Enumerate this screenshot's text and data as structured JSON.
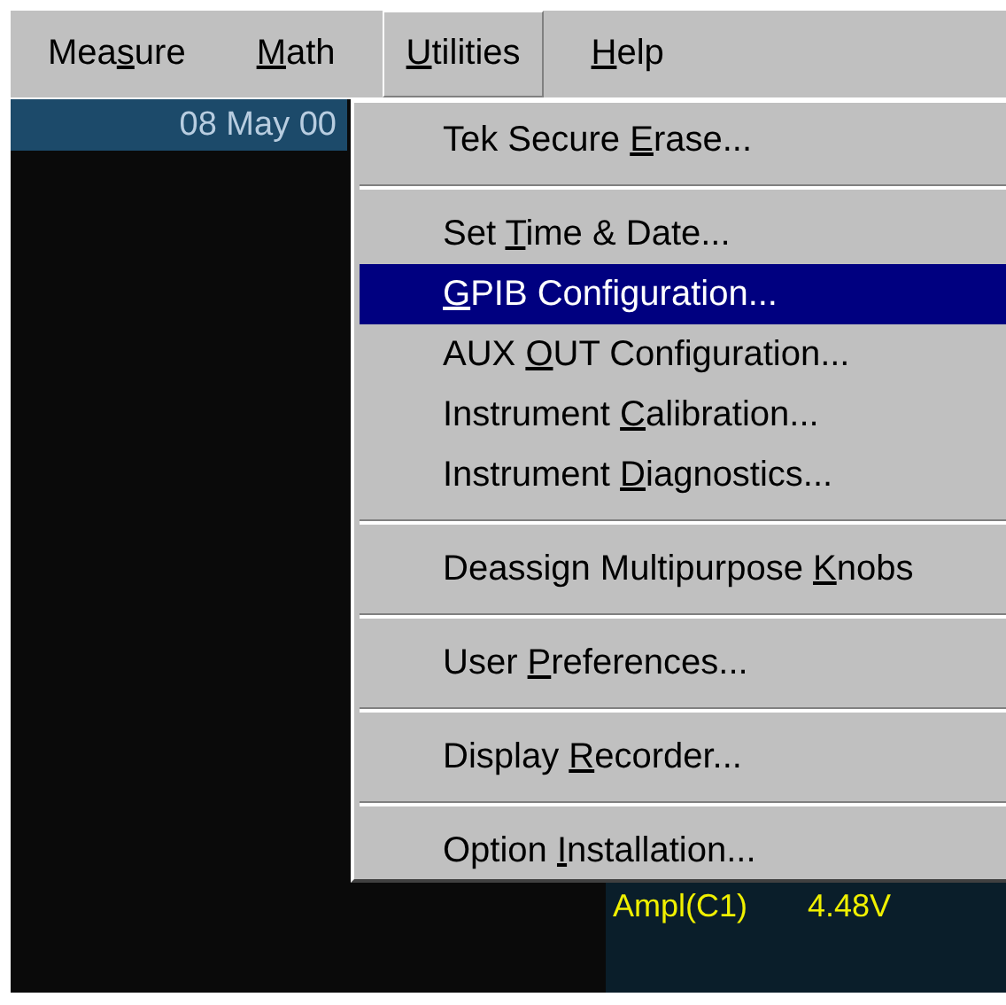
{
  "menubar": [
    {
      "label": {
        "before": "Mea",
        "key": "s",
        "after": "ure"
      },
      "selected": false
    },
    {
      "label": {
        "key": "M",
        "after": "ath"
      },
      "selected": false
    },
    {
      "label": {
        "key": "U",
        "after": "tilities"
      },
      "selected": true
    },
    {
      "label": {
        "key": "H",
        "after": "elp"
      },
      "selected": false
    }
  ],
  "date": "08 May 00",
  "menu": [
    {
      "kind": "item",
      "label": {
        "before": "Tek Secure ",
        "key": "E",
        "after": "rase..."
      },
      "selected": false
    },
    {
      "kind": "separator"
    },
    {
      "kind": "item",
      "label": {
        "before": "Set ",
        "key": "T",
        "after": "ime & Date..."
      },
      "selected": false
    },
    {
      "kind": "item",
      "label": {
        "key": "G",
        "after": "PIB Configuration..."
      },
      "selected": true
    },
    {
      "kind": "item",
      "label": {
        "before": "AUX ",
        "key": "O",
        "after": "UT Configuration..."
      },
      "selected": false
    },
    {
      "kind": "item",
      "label": {
        "before": "Instrument ",
        "key": "C",
        "after": "alibration..."
      },
      "selected": false
    },
    {
      "kind": "item",
      "label": {
        "before": "Instrument ",
        "key": "D",
        "after": "iagnostics..."
      },
      "selected": false
    },
    {
      "kind": "separator"
    },
    {
      "kind": "item",
      "label": {
        "before": "Deassign Multipurpose ",
        "key": "K",
        "after": "nobs"
      },
      "selected": false
    },
    {
      "kind": "separator"
    },
    {
      "kind": "item",
      "label": {
        "before": "User ",
        "key": "P",
        "after": "references..."
      },
      "selected": false
    },
    {
      "kind": "separator"
    },
    {
      "kind": "item",
      "label": {
        "before": "Display ",
        "key": "R",
        "after": "ecorder..."
      },
      "selected": false
    },
    {
      "kind": "separator"
    },
    {
      "kind": "item",
      "label": {
        "before": "Option ",
        "key": "I",
        "after": "nstallation..."
      },
      "selected": false
    }
  ],
  "measurement": {
    "name": "Ampl(C1)",
    "value": "4.48V"
  }
}
